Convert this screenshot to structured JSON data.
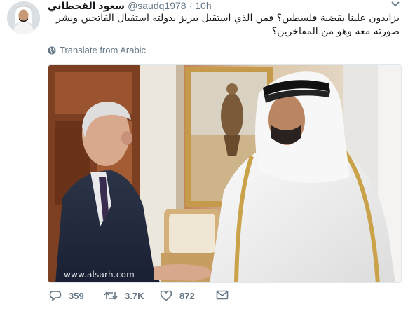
{
  "tweet": {
    "display_name": "سعود القحطاني",
    "handle": "@saudq1978",
    "separator": "·",
    "time": "10h",
    "text": "يزايدون علينا بقضية فلسطين؟ فمن الذي استقبل بيريز بدولته استقبال الفاتحين ونشر صورته معه وهو من المفاخرين؟",
    "translate_label": "Translate from Arabic",
    "photo_watermark": "www.alsarh.com"
  },
  "actions": {
    "replies": "359",
    "retweets": "3.7K",
    "likes": "872"
  },
  "icons": {
    "avatar": "avatar",
    "caret": "chevron-down-icon",
    "globe": "globe-icon",
    "reply": "reply-icon",
    "retweet": "retweet-icon",
    "like": "heart-icon",
    "dm": "envelope-icon"
  },
  "colors": {
    "secondary_text": "#657786",
    "primary_text": "#14171a"
  }
}
